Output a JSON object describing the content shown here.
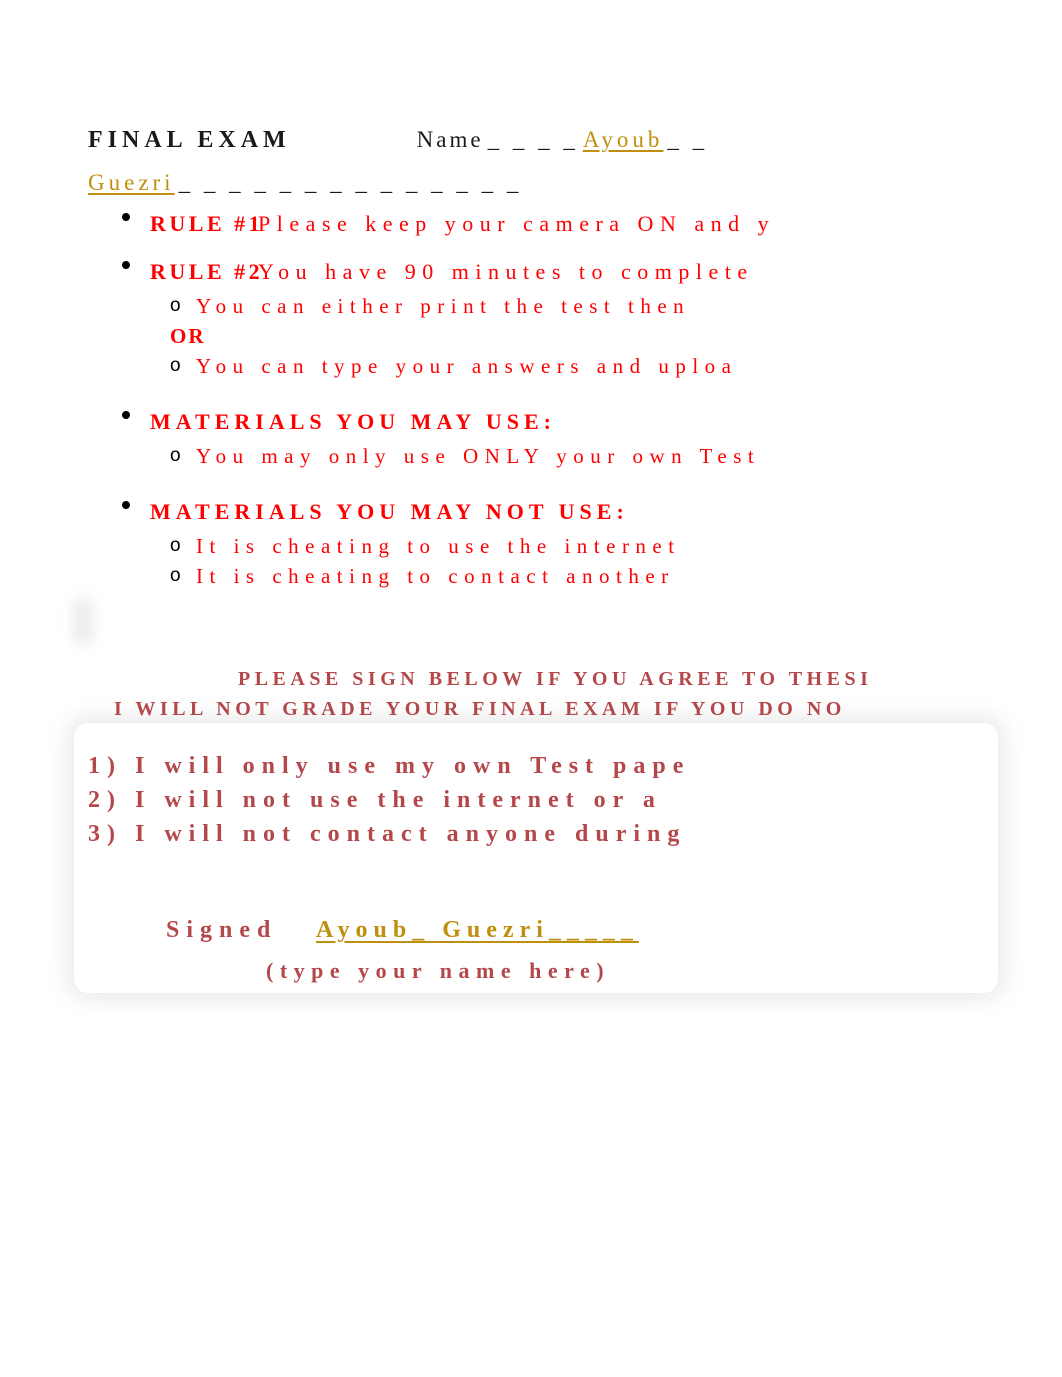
{
  "document": {
    "title": "FINAL EXAM",
    "name_label": "Name",
    "name_dashes_before": "_ _ _ _",
    "name_value": "Ayoub",
    "name_dashes_after": "_ _",
    "name_value_line2": "Guezri",
    "name_dashes_line2": "_ _ _ _ _ _ _ _ _ _ _ _ _ _"
  },
  "rules": [
    {
      "tag": "RULE #1",
      "text": "Please keep your camera ON and y",
      "sub_items": []
    },
    {
      "tag": "RULE #2",
      "text": "You have 90 minutes to complete",
      "sub_items": [
        {
          "marker": "o",
          "text": "You can either print the test then"
        },
        {
          "marker": "",
          "text": "OR"
        },
        {
          "marker": "o",
          "text": "You can type your answers and uploa"
        }
      ]
    }
  ],
  "sections": [
    {
      "heading": "MATERIALS YOU MAY USE:",
      "sub_items": [
        {
          "marker": "o",
          "text": "You may only use ONLY your own Test"
        }
      ]
    },
    {
      "heading": "MATERIALS YOU MAY NOT USE:",
      "sub_items": [
        {
          "marker": "o",
          "text": "It is cheating to use the internet"
        },
        {
          "marker": "o",
          "text": "It is cheating to contact another"
        }
      ]
    }
  ],
  "agreement": {
    "heading_line_1": "PLEASE SIGN BELOW IF YOU AGREE TO THESI",
    "heading_line_2": "I WILL NOT GRADE YOUR FINAL EXAM IF YOU DO NO",
    "pledges": [
      "1)  I will only use my own Test pape",
      "2)  I will not use the internet or a",
      "3)  I will not contact anyone during"
    ],
    "signed_label": "Signed",
    "signed_value": "Ayoub_ Guezri_____",
    "type_name_hint": "(type your name here)"
  },
  "colors": {
    "rule_red": "#ff0000",
    "agreement_red": "#b4474a",
    "name_gold": "#bf8f0d",
    "title_black": "#1a1a1a",
    "page_background": "#ffffff"
  }
}
